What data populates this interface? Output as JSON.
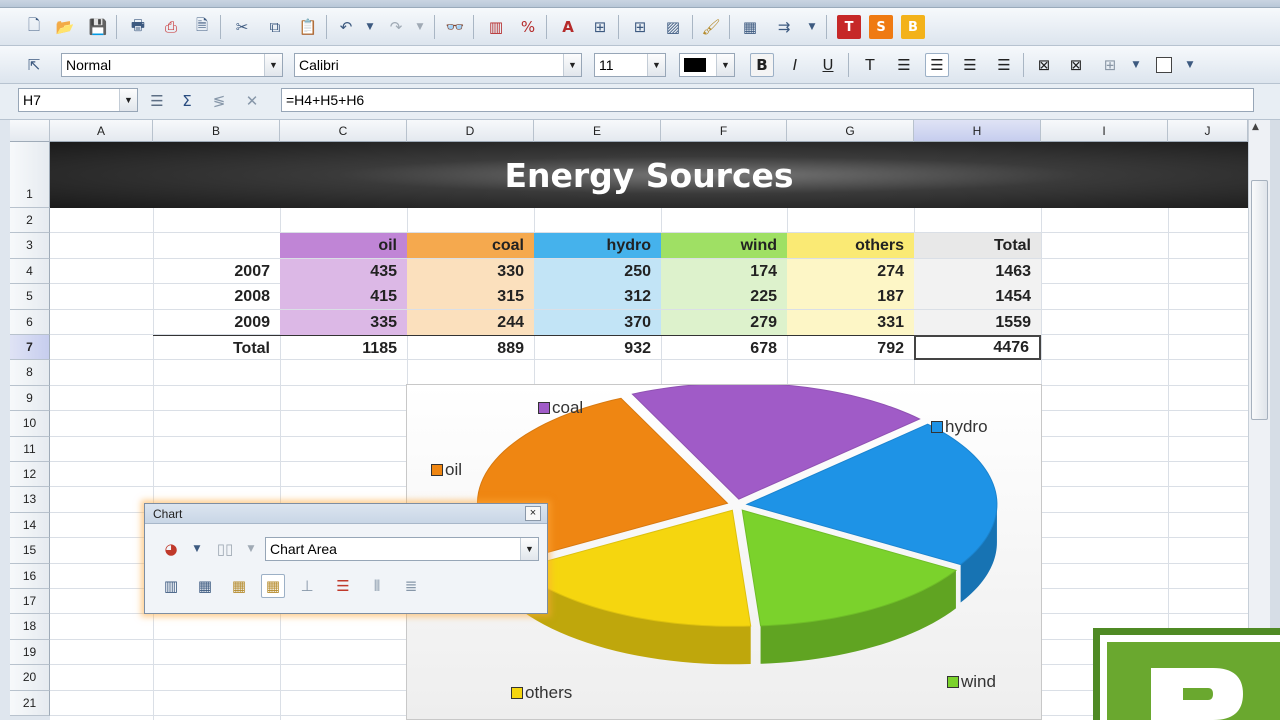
{
  "toolbar_format": {
    "style_value": "Normal",
    "font_value": "Calibri",
    "size_value": "11"
  },
  "formula_bar": {
    "cell_ref": "H7",
    "formula": "=H4+H5+H6"
  },
  "columns": [
    "A",
    "B",
    "C",
    "D",
    "E",
    "F",
    "G",
    "H",
    "I",
    "J"
  ],
  "rows": [
    "1",
    "2",
    "3",
    "4",
    "5",
    "6",
    "7",
    "8",
    "9",
    "10",
    "11",
    "12",
    "13",
    "14",
    "15",
    "16",
    "17",
    "18",
    "19",
    "20",
    "21"
  ],
  "sheet": {
    "title": "Energy Sources",
    "headers": [
      "oil",
      "coal",
      "hydro",
      "wind",
      "others",
      "Total"
    ],
    "data_rows": [
      {
        "label": "2007",
        "values": [
          "435",
          "330",
          "250",
          "174",
          "274",
          "1463"
        ]
      },
      {
        "label": "2008",
        "values": [
          "415",
          "315",
          "312",
          "225",
          "187",
          "1454"
        ]
      },
      {
        "label": "2009",
        "values": [
          "335",
          "244",
          "370",
          "279",
          "331",
          "1559"
        ]
      }
    ],
    "total_row": {
      "label": "Total",
      "values": [
        "1185",
        "889",
        "932",
        "678",
        "792",
        "4476"
      ]
    }
  },
  "header_colors": [
    "#c085d6",
    "#f5a94e",
    "#45b2ec",
    "#9fe064",
    "#faea74",
    "#e8e8e8"
  ],
  "cell_colors": [
    "#dcb8e6",
    "#fbe0bd",
    "#c2e4f6",
    "#ddf2cc",
    "#fdf6c6",
    "#f2f2f2"
  ],
  "chart": {
    "legend": {
      "coal": "coal",
      "hydro": "hydro",
      "oil": "oil",
      "others": "others",
      "wind": "wind"
    },
    "colors": {
      "coal": "#a05bc7",
      "hydro": "#1e93e6",
      "oil": "#ef8612",
      "others": "#f5d60f",
      "wind": "#7bd22c"
    }
  },
  "chart_panel": {
    "title": "Chart",
    "close": "×",
    "element_value": "Chart Area"
  },
  "icons": [
    "new-doc-icon",
    "open-icon",
    "save-icon",
    "print-icon",
    "pdf-icon",
    "preview-icon",
    "cut-icon",
    "copy-icon",
    "paste-icon",
    "undo-icon",
    "redo-icon",
    "find-icon",
    "chart-icon",
    "zoom-icon",
    "text-icon",
    "borders-icon",
    "shade-icon",
    "clear-format-icon",
    "function-icon",
    "sort-icon",
    "pivot-icon",
    "sum-icon"
  ],
  "chart_data": {
    "type": "pie",
    "categories": [
      "oil",
      "coal",
      "hydro",
      "wind",
      "others"
    ],
    "values": [
      1185,
      889,
      932,
      678,
      792
    ]
  }
}
